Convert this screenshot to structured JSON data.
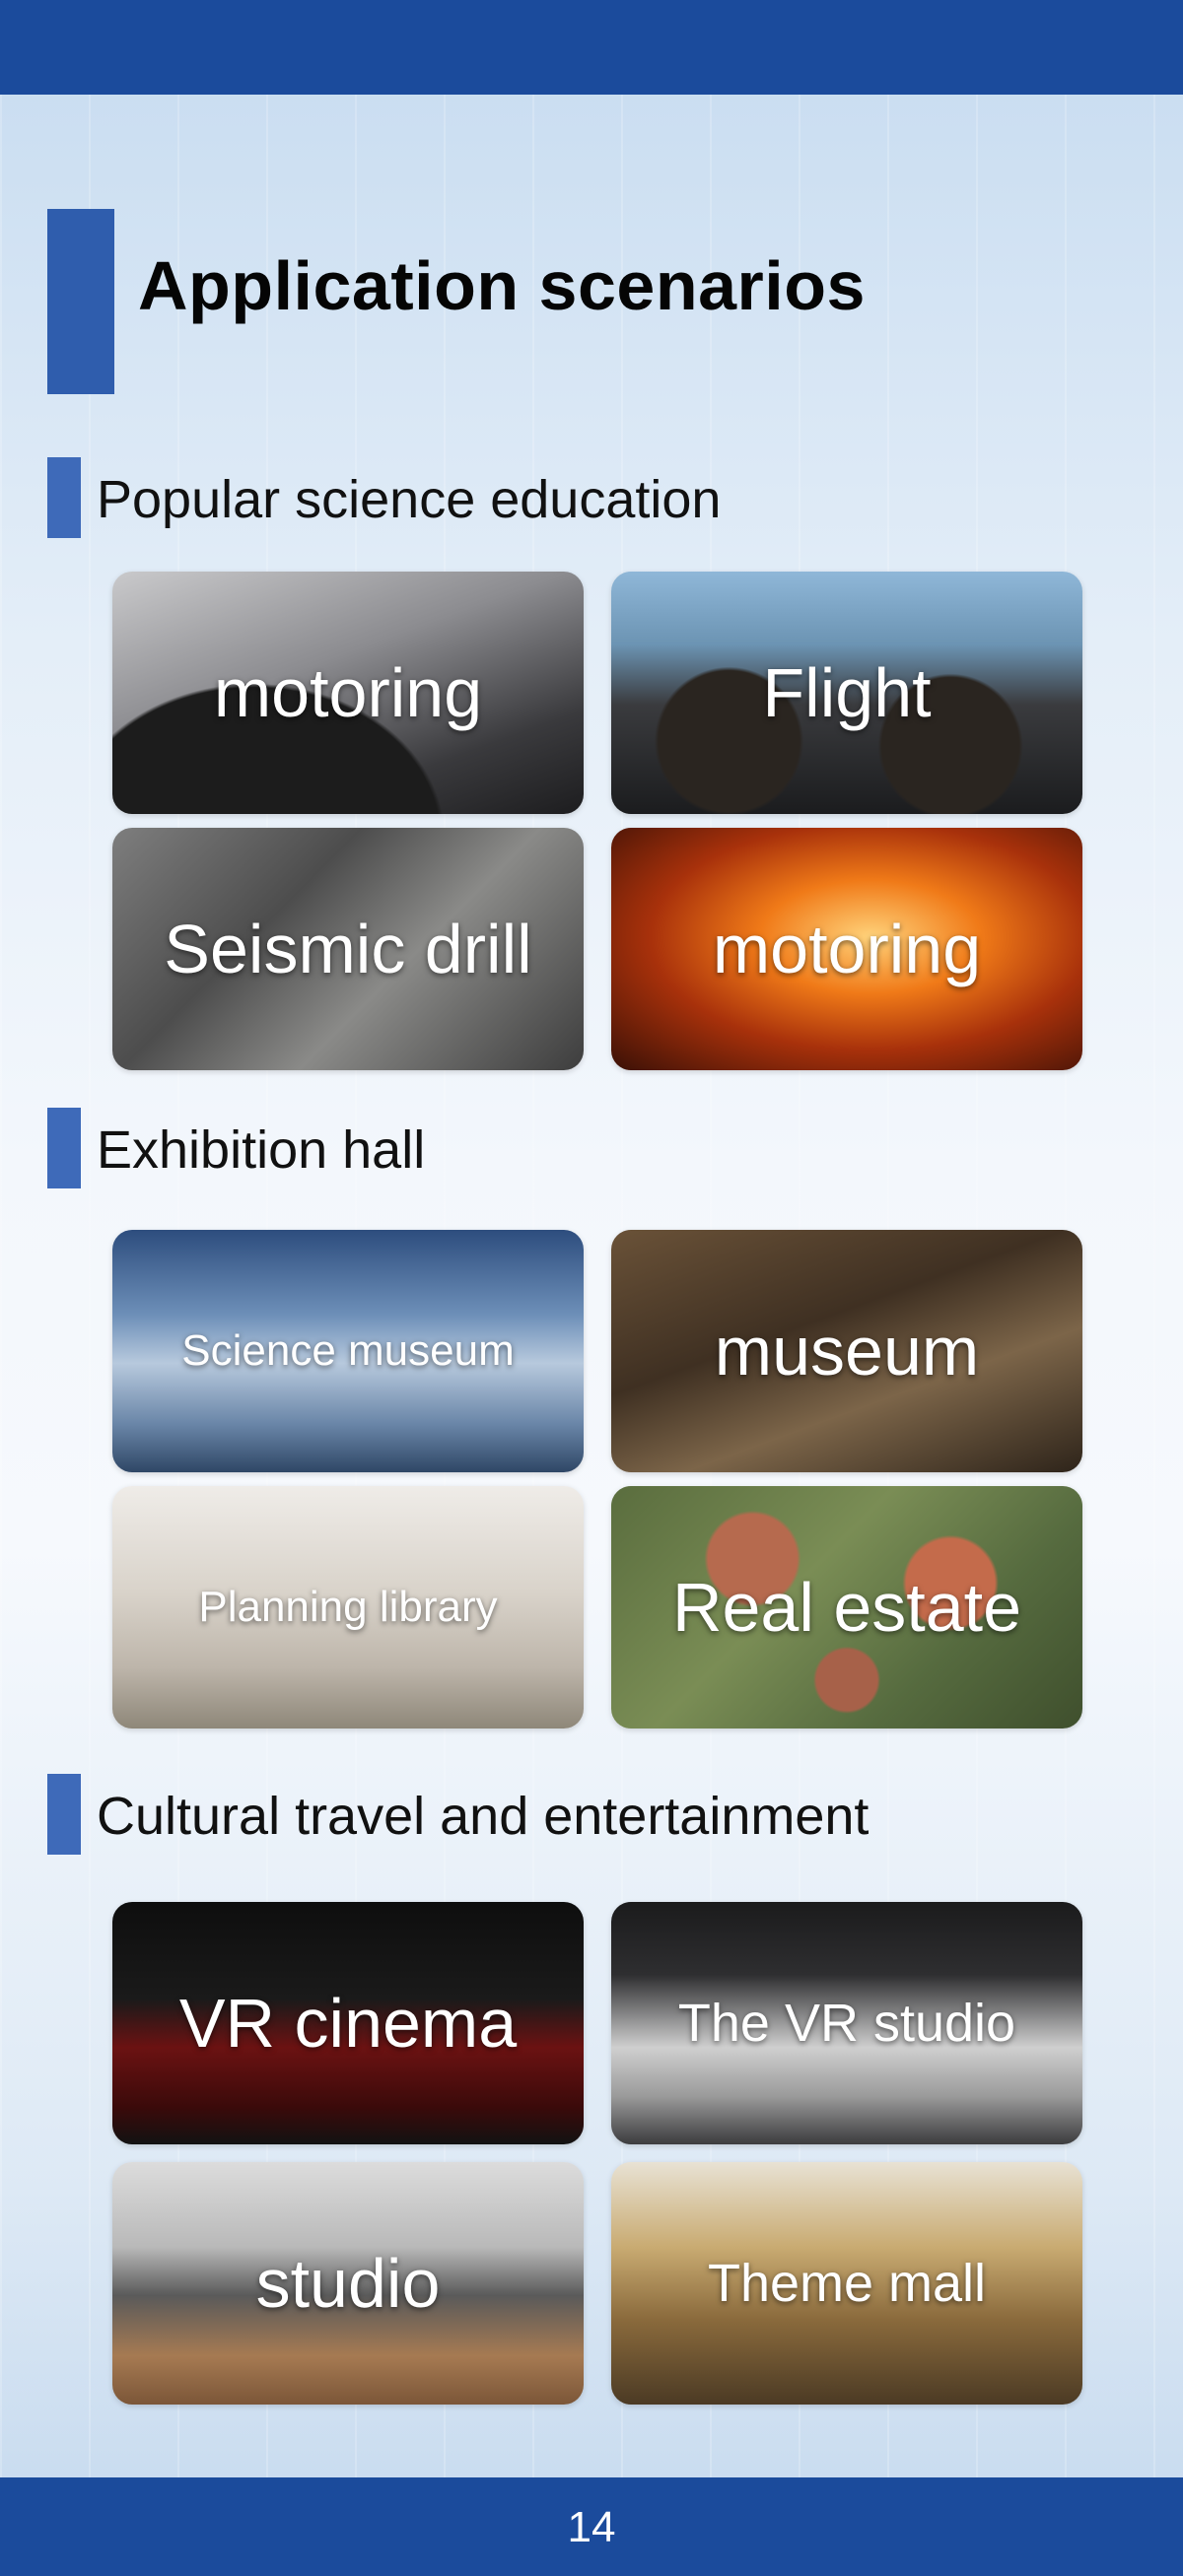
{
  "page": {
    "title": "Application scenarios",
    "page_number": "14"
  },
  "sections": [
    {
      "title": "Popular science education",
      "tiles": [
        "motoring",
        "Flight",
        "Seismic drill",
        "motoring"
      ]
    },
    {
      "title": "Exhibition hall",
      "tiles": [
        "Science museum",
        "museum",
        "Planning library",
        "Real estate"
      ]
    },
    {
      "title": "Cultural travel and entertainment",
      "tiles": [
        "VR cinema",
        "The VR studio",
        "studio",
        "Theme mall"
      ]
    }
  ],
  "colors": {
    "header_bar": "#1b4b9c",
    "accent_marker": "#2f5dad"
  }
}
